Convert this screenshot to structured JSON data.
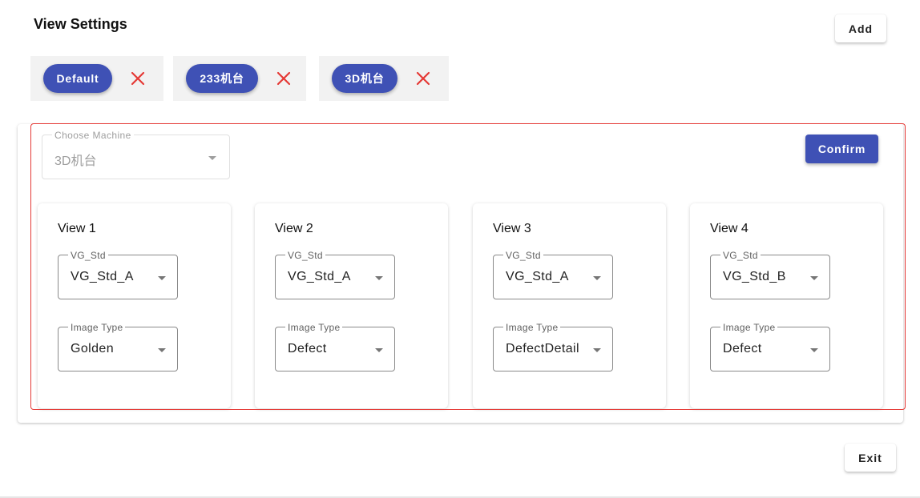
{
  "page": {
    "title": "View Settings"
  },
  "toolbar": {
    "add_label": "Add",
    "exit_label": "Exit"
  },
  "machines": [
    {
      "label": "Default"
    },
    {
      "label": "233机台"
    },
    {
      "label": "3D机台"
    }
  ],
  "machine_select": {
    "legend": "Choose Machine",
    "value": "3D机台",
    "disabled": true
  },
  "confirm_label": "Confirm",
  "views": [
    {
      "title": "View 1",
      "vg": {
        "legend": "VG_Std",
        "value": "VG_Std_A"
      },
      "image_type": {
        "legend": "Image Type",
        "value": "Golden"
      }
    },
    {
      "title": "View 2",
      "vg": {
        "legend": "VG_Std",
        "value": "VG_Std_A"
      },
      "image_type": {
        "legend": "Image Type",
        "value": "Defect"
      }
    },
    {
      "title": "View 3",
      "vg": {
        "legend": "VG_Std",
        "value": "VG_Std_A"
      },
      "image_type": {
        "legend": "Image Type",
        "value": "DefectDetail"
      }
    },
    {
      "title": "View 4",
      "vg": {
        "legend": "VG_Std",
        "value": "VG_Std_B"
      },
      "image_type": {
        "legend": "Image Type",
        "value": "Defect"
      }
    }
  ],
  "colors": {
    "primary": "#3f51b5",
    "delete": "#e53935",
    "highlight": "#e53935",
    "chip_bg": "#f2f2f2"
  },
  "icons": {
    "delete": "close-icon",
    "dropdown": "chevron-down-icon"
  }
}
